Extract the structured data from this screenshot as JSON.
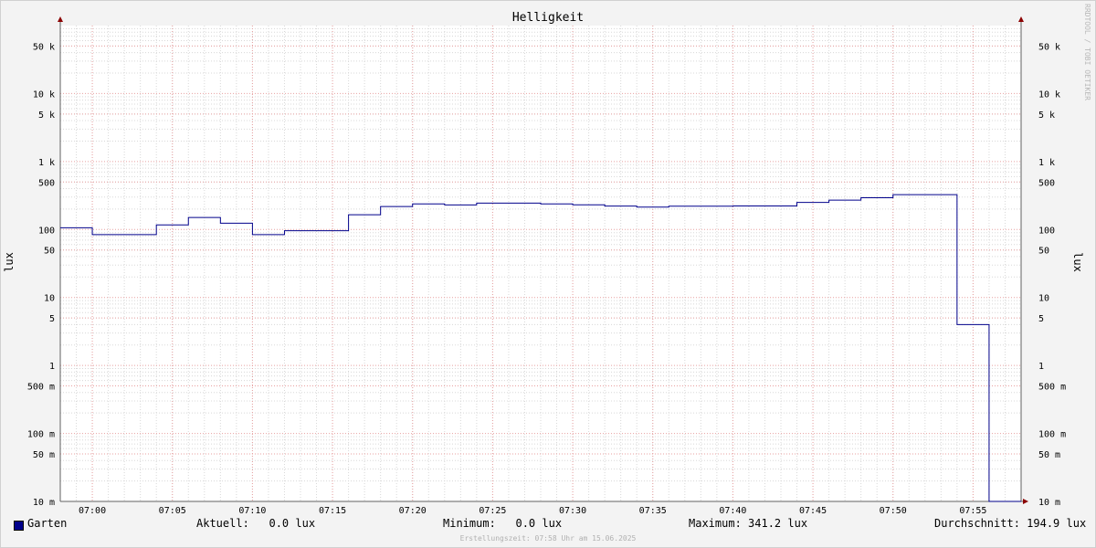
{
  "chart_data": {
    "type": "line",
    "title": "Helligkeit",
    "ylabel": "lux",
    "y_scale": "log",
    "ylim": [
      0.01,
      100000
    ],
    "xlim": [
      "06:58",
      "07:58"
    ],
    "x_ticks": [
      "07:00",
      "07:05",
      "07:10",
      "07:15",
      "07:20",
      "07:25",
      "07:30",
      "07:35",
      "07:40",
      "07:45",
      "07:50",
      "07:55"
    ],
    "y_ticks": [
      {
        "value": 50000,
        "label": "50 k"
      },
      {
        "value": 10000,
        "label": "10 k"
      },
      {
        "value": 5000,
        "label": "5 k"
      },
      {
        "value": 1000,
        "label": "1 k"
      },
      {
        "value": 500,
        "label": "500"
      },
      {
        "value": 100,
        "label": "100"
      },
      {
        "value": 50,
        "label": "50"
      },
      {
        "value": 10,
        "label": "10"
      },
      {
        "value": 5,
        "label": "5"
      },
      {
        "value": 1,
        "label": "1"
      },
      {
        "value": 0.5,
        "label": "500 m"
      },
      {
        "value": 0.1,
        "label": "100 m"
      },
      {
        "value": 0.05,
        "label": "50 m"
      },
      {
        "value": 0.01,
        "label": "10 m"
      }
    ],
    "grid": true,
    "series": [
      {
        "name": "Garten",
        "color": "#00008b",
        "step": "post",
        "points": [
          [
            "06:58",
            106
          ],
          [
            "07:00",
            84
          ],
          [
            "07:04",
            117
          ],
          [
            "07:06",
            150
          ],
          [
            "07:08",
            124
          ],
          [
            "07:10",
            84
          ],
          [
            "07:12",
            96
          ],
          [
            "07:16",
            165
          ],
          [
            "07:18",
            218
          ],
          [
            "07:20",
            238
          ],
          [
            "07:22",
            230
          ],
          [
            "07:24",
            245
          ],
          [
            "07:28",
            238
          ],
          [
            "07:30",
            231
          ],
          [
            "07:32",
            221
          ],
          [
            "07:34",
            214
          ],
          [
            "07:36",
            220
          ],
          [
            "07:40",
            222
          ],
          [
            "07:44",
            250
          ],
          [
            "07:46",
            270
          ],
          [
            "07:48",
            293
          ],
          [
            "07:50",
            325
          ],
          [
            "07:54",
            4
          ],
          [
            "07:56",
            0.01
          ],
          [
            "07:58",
            0.01
          ]
        ]
      }
    ]
  },
  "legend": {
    "series_name": "Garten",
    "aktuell": "Aktuell:   0.0 lux",
    "minimum": "Minimum:   0.0 lux",
    "maximum": "Maximum: 341.2 lux",
    "durchschnitt": "Durchschnitt: 194.9 lux"
  },
  "footer": "Erstellungszeit: 07:58 Uhr am 15.06.2025",
  "watermark": "RRDTOOL / TOBI OETIKER"
}
